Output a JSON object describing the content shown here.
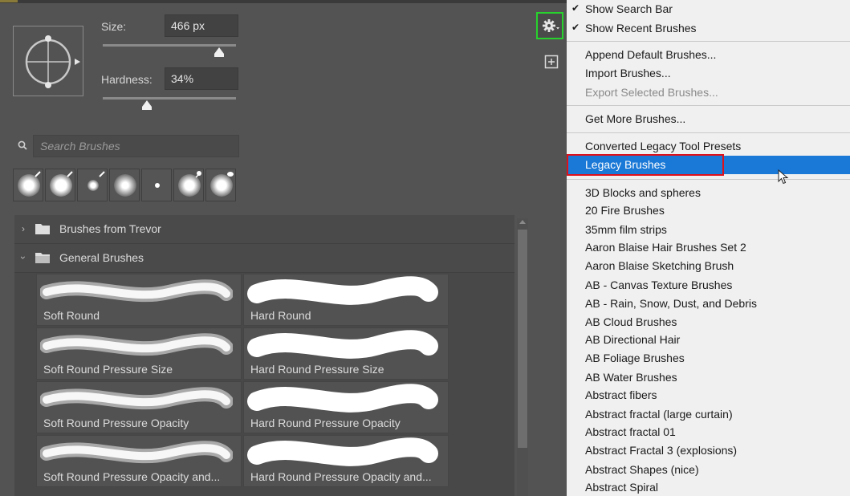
{
  "brush_panel": {
    "size_label": "Size:",
    "size_value": "466 px",
    "hardness_label": "Hardness:",
    "hardness_value": "34%",
    "search_placeholder": "Search Brushes",
    "folders": [
      {
        "name": "Brushes from Trevor",
        "expanded": false
      },
      {
        "name": "General Brushes",
        "expanded": true
      }
    ],
    "presets": [
      "Soft Round",
      "Hard Round",
      "Soft Round Pressure Size",
      "Hard Round Pressure Size",
      "Soft Round Pressure Opacity",
      "Hard Round Pressure Opacity",
      "Soft Round Pressure Opacity and...",
      "Hard Round Pressure Opacity and..."
    ],
    "icons": {
      "settings": "gear-icon",
      "new_brush": "plus-square-icon",
      "search": "search-icon",
      "folder": "folder-icon"
    }
  },
  "menu": {
    "items": [
      {
        "label": "Show Search Bar",
        "checked": true
      },
      {
        "label": "Show Recent Brushes",
        "checked": true
      },
      {
        "label": "Append Default Brushes..."
      },
      {
        "label": "Import Brushes..."
      },
      {
        "label": "Export Selected Brushes...",
        "disabled": true
      },
      {
        "label": "Get More Brushes..."
      },
      {
        "label": "Converted Legacy Tool Presets"
      },
      {
        "label": "Legacy Brushes",
        "highlighted": true
      },
      {
        "label": "3D Blocks and spheres"
      },
      {
        "label": "20 Fire Brushes"
      },
      {
        "label": "35mm film strips"
      },
      {
        "label": "Aaron Blaise Hair Brushes Set 2"
      },
      {
        "label": "Aaron Blaise Sketching Brush"
      },
      {
        "label": "AB - Canvas Texture Brushes"
      },
      {
        "label": "AB - Rain, Snow, Dust, and Debris"
      },
      {
        "label": "AB Cloud Brushes"
      },
      {
        "label": "AB Directional Hair"
      },
      {
        "label": "AB Foliage Brushes"
      },
      {
        "label": "AB Water Brushes"
      },
      {
        "label": "Abstract fibers"
      },
      {
        "label": "Abstract fractal (large curtain)"
      },
      {
        "label": "Abstract fractal 01"
      },
      {
        "label": "Abstract Fractal 3 (explosions)"
      },
      {
        "label": "Abstract Shapes (nice)"
      },
      {
        "label": "Abstract Spiral"
      }
    ]
  },
  "colors": {
    "highlight": "#1a78d6",
    "green_outline": "#27d22d",
    "red_outline": "#e0101a"
  }
}
